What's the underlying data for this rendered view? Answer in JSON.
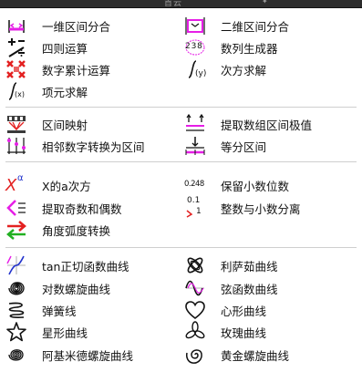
{
  "title": "首云",
  "rows": [
    {
      "left": "一维区间分合",
      "right": "二维区间分合"
    },
    {
      "left": "四则运算",
      "right": "数列生成器"
    },
    {
      "left": "数字累计运算",
      "right": "次方求解"
    },
    {
      "left": "项元求解",
      "right": ""
    },
    {
      "left": "区间映射",
      "right": "提取数组区间极值"
    },
    {
      "left": "相邻数字转换为区间",
      "right": "等分区间"
    },
    {
      "left": "X的a次方",
      "right": "保留小数位数"
    },
    {
      "left": "提取奇数和偶数",
      "right": "整数与小数分离"
    },
    {
      "left": "角度弧度转换",
      "right": ""
    },
    {
      "left": "tan正切函数曲线",
      "right": "利萨茹曲线"
    },
    {
      "left": "对数螺旋曲线",
      "right": "弦函数曲线"
    },
    {
      "left": "弹簧线",
      "right": "心形曲线"
    },
    {
      "left": "星形曲线",
      "right": "玫瑰曲线"
    },
    {
      "left": "阿基米德螺旋曲线",
      "right": "黄金螺旋曲线"
    }
  ],
  "icon_text": {
    "seq": "2 3 8",
    "power": "X",
    "power_sup": "α",
    "decimal": "0.248",
    "intfrac_top": "0.1",
    "intfrac_bot": "1"
  },
  "colors": {
    "accent": "#e61ee6",
    "red": "#e32020",
    "green": "#22b022"
  }
}
